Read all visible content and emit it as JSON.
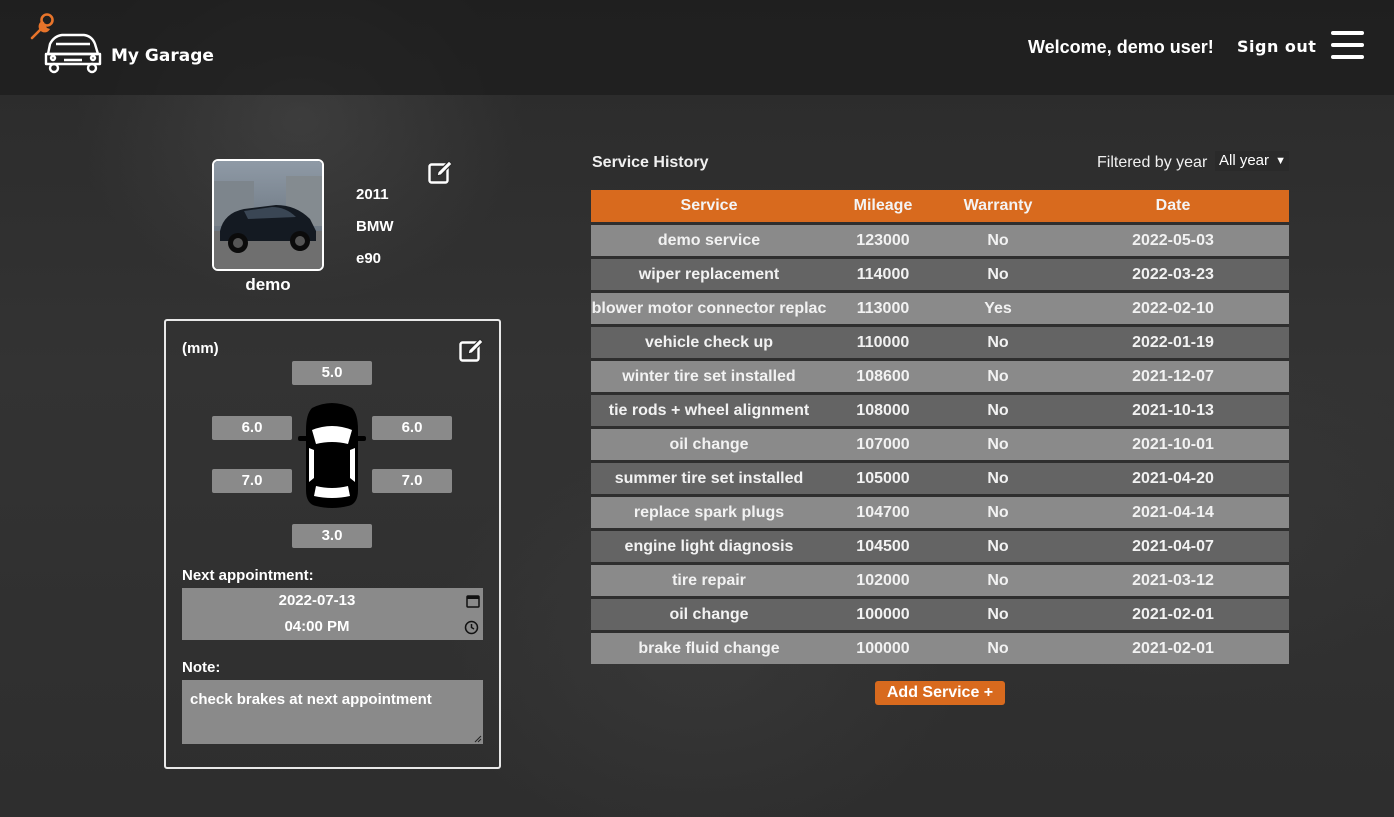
{
  "header": {
    "brand": "My Garage",
    "welcome": "Welcome, demo user!",
    "sign_out": "Sign out"
  },
  "vehicle": {
    "name": "demo",
    "year": "2011",
    "make": "BMW",
    "model": "e90"
  },
  "tires": {
    "unit_label": "(mm)",
    "front": "5.0",
    "front_left": "6.0",
    "front_right": "6.0",
    "rear_left": "7.0",
    "rear_right": "7.0",
    "rear": "3.0"
  },
  "appointment": {
    "label": "Next appointment:",
    "date": "2022-07-13",
    "time": "04:00  PM"
  },
  "note": {
    "label": "Note:",
    "text": "check brakes at next appointment"
  },
  "service_history": {
    "title": "Service History",
    "filter_label": "Filtered by year",
    "filter_value": "All year",
    "columns": [
      "Service",
      "Mileage",
      "Warranty",
      "Date"
    ],
    "rows": [
      [
        "demo service",
        "123000",
        "No",
        "2022-05-03"
      ],
      [
        "wiper replacement",
        "114000",
        "No",
        "2022-03-23"
      ],
      [
        "blower motor connector replac",
        "113000",
        "Yes",
        "2022-02-10"
      ],
      [
        "vehicle check up",
        "110000",
        "No",
        "2022-01-19"
      ],
      [
        "winter tire set installed",
        "108600",
        "No",
        "2021-12-07"
      ],
      [
        "tie rods + wheel alignment",
        "108000",
        "No",
        "2021-10-13"
      ],
      [
        "oil change",
        "107000",
        "No",
        "2021-10-01"
      ],
      [
        "summer tire set installed",
        "105000",
        "No",
        "2021-04-20"
      ],
      [
        "replace spark plugs",
        "104700",
        "No",
        "2021-04-14"
      ],
      [
        "engine light diagnosis",
        "104500",
        "No",
        "2021-04-07"
      ],
      [
        "tire repair",
        "102000",
        "No",
        "2021-03-12"
      ],
      [
        "oil change",
        "100000",
        "No",
        "2021-02-01"
      ],
      [
        "brake fluid change",
        "100000",
        "No",
        "2021-02-01"
      ]
    ],
    "add_button": "Add Service +"
  },
  "colors": {
    "accent": "#d86a1e",
    "row_light": "#8a8a8a",
    "row_dark": "#646464"
  },
  "icons": [
    "wrench-icon",
    "car-logo-icon",
    "hamburger-menu-icon",
    "edit-icon",
    "calendar-icon",
    "clock-icon",
    "car-top-view-icon"
  ]
}
